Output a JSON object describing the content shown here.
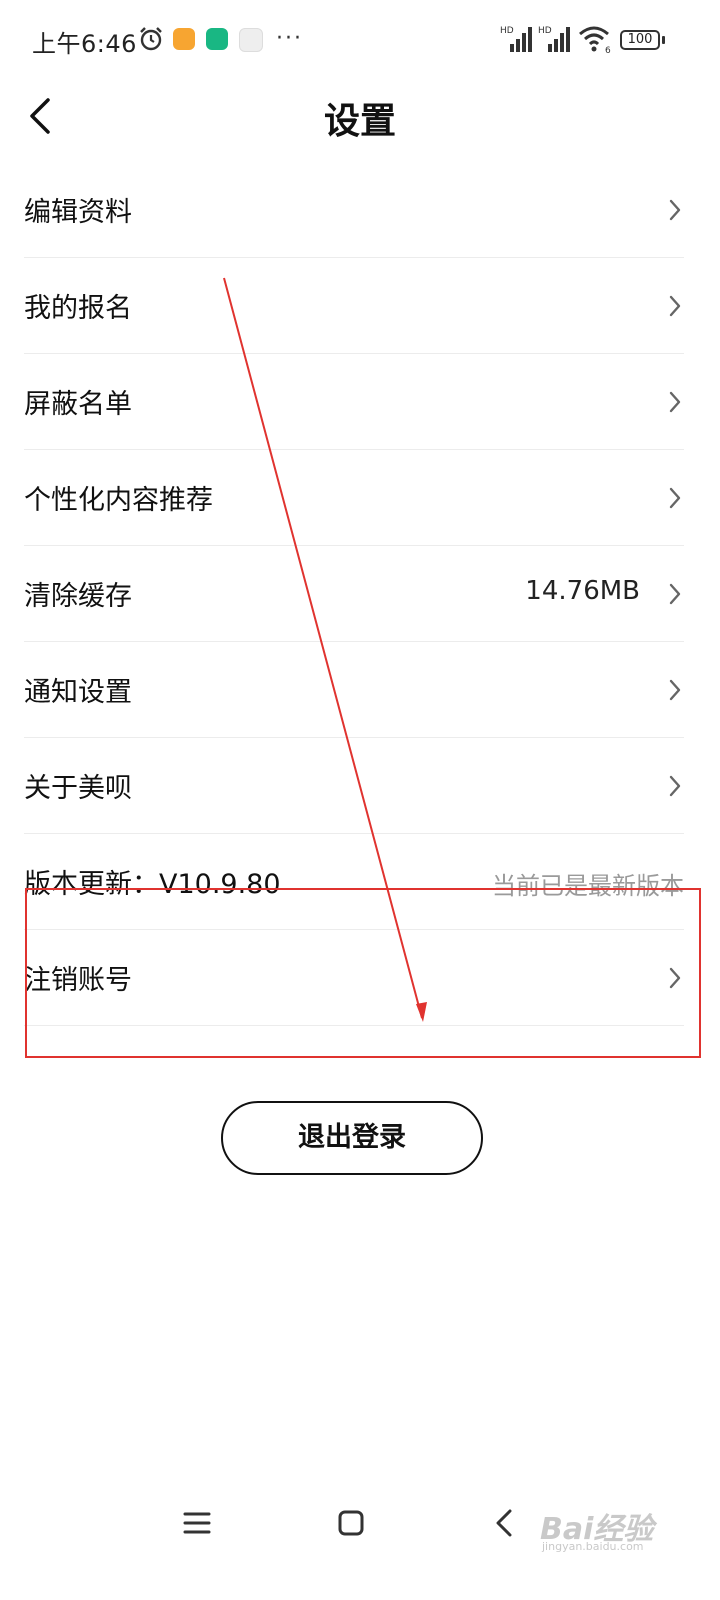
{
  "status_bar": {
    "time": "上午6:46",
    "more": "···",
    "signal1_label": "HD",
    "signal2_label": "HD",
    "wifi_label": "6",
    "battery": "100"
  },
  "header": {
    "title": "设置",
    "back_icon": "chevron-left-icon"
  },
  "settings": {
    "items": [
      {
        "label": "编辑资料"
      },
      {
        "label": "我的报名"
      },
      {
        "label": "屏蔽名单"
      },
      {
        "label": "个性化内容推荐"
      },
      {
        "label": "清除缓存",
        "value": "14.76MB"
      },
      {
        "label": "通知设置"
      },
      {
        "label": "关于美呗"
      },
      {
        "label": "版本更新：V10.9.80",
        "note": "当前已是最新版本"
      },
      {
        "label": "注销账号"
      }
    ]
  },
  "logout": {
    "label": "退出登录"
  },
  "nav": {
    "icons": [
      "menu-icon",
      "home-icon",
      "back-icon"
    ]
  },
  "watermark": {
    "brand": "Bai经验",
    "sub": "jingyan.baidu.com"
  },
  "colors": {
    "annotation": "#e0332f",
    "note": "#9a9a9a",
    "divider": "#ececec"
  }
}
